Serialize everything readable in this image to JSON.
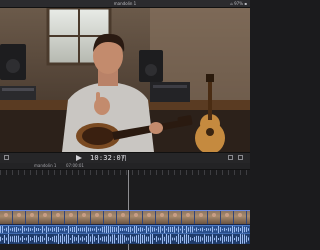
{
  "window": {
    "title": "mandolin 1",
    "status_right": "⌂ 97% ▪"
  },
  "viewer": {
    "scene": "man-playing-mandolin-in-home-studio"
  },
  "transport": {
    "timecode": "10:32:07"
  },
  "timeline": {
    "project_name": "mandolin 1",
    "project_timecode": "07:00:01"
  },
  "colors": {
    "accent": "#4d7cc8",
    "clip": "#2d3d6e",
    "audio": "#2a4f8c"
  }
}
